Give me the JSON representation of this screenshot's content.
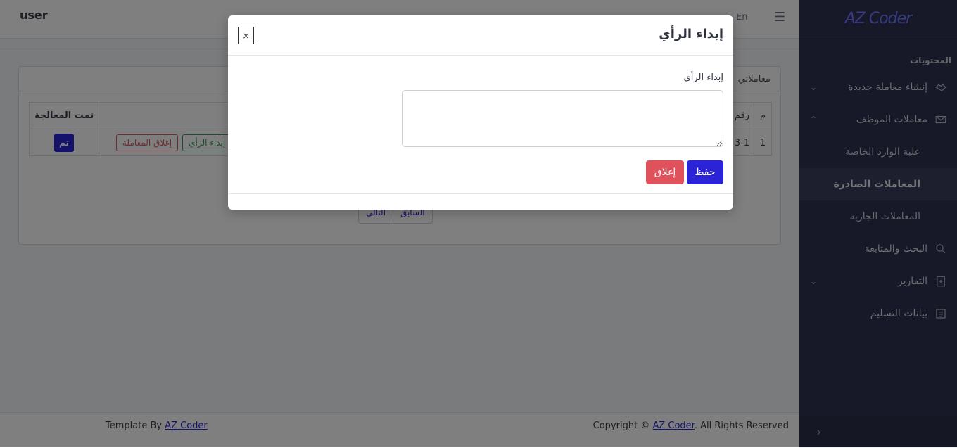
{
  "topbar": {
    "user": "user",
    "lang": "En",
    "menu_icon": "hamburger-icon"
  },
  "sidebar": {
    "brand": "AZ Coder",
    "section_title": "المحتويات",
    "items": [
      {
        "label": "إنشاء معاملة جديدة",
        "icon": "handshake-icon",
        "chevron": "chevron-down-icon"
      },
      {
        "label": "معاملات الموظف",
        "icon": "mail-icon",
        "chevron": "chevron-up-icon"
      },
      {
        "label": "البحث والمتابعة",
        "icon": "search-icon"
      },
      {
        "label": "التقارير",
        "icon": "report-icon",
        "chevron": "chevron-down-icon"
      },
      {
        "label": "بيانات التسليم",
        "icon": "document-icon"
      }
    ],
    "subitems": [
      {
        "label": "علبة الوارد الخاصة"
      },
      {
        "label": "المعاملات الصادرة"
      },
      {
        "label": "المعاملات الجارية"
      }
    ],
    "footer_icon": "chevron-right-icon"
  },
  "content": {
    "card_title": "معاملاتي",
    "headers": {
      "done": "تمت المعالجة",
      "number": "رقم",
      "index": "م"
    },
    "row": {
      "done_button": "تم",
      "close_txn": "إغلاق المعاملة",
      "opinion": "إبداء الرأي",
      "number": "3-1",
      "index": "1"
    },
    "pager": {
      "next": "التالي",
      "prev": "السابق"
    }
  },
  "footer": {
    "left_prefix": "Template By",
    "left_link": "AZ Coder",
    "right_prefix": "Copyright ©",
    "right_link": "AZ Coder",
    "right_suffix": ". All Rights Reserved"
  },
  "modal": {
    "title": "إبداء الرأي",
    "close_x": "×",
    "field_label": "إبداء الرأي",
    "textarea_value": "",
    "save": "حفظ",
    "close": "إغلاق"
  }
}
